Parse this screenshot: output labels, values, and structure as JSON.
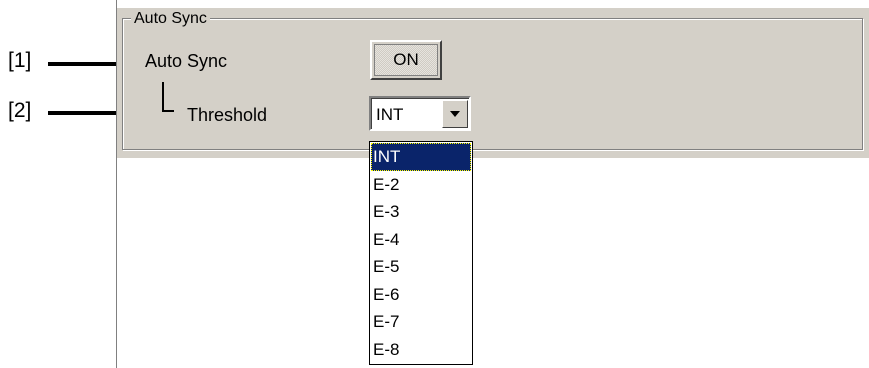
{
  "annotations": {
    "one": "[1]",
    "two": "[2]"
  },
  "group": {
    "title": "Auto Sync"
  },
  "auto_sync": {
    "label": "Auto Sync",
    "button_label": "ON"
  },
  "threshold": {
    "label": "Threshold",
    "selected_value": "INT",
    "options": [
      "INT",
      "E-2",
      "E-3",
      "E-4",
      "E-5",
      "E-6",
      "E-7",
      "E-8"
    ],
    "highlighted_index": 0
  },
  "colors": {
    "panel_bg": "#d4d0c8",
    "selection": "#0a246a"
  },
  "icons": {
    "combo_arrow": "triangle-down-icon",
    "annotation_arrow": "arrow-right-icon"
  }
}
